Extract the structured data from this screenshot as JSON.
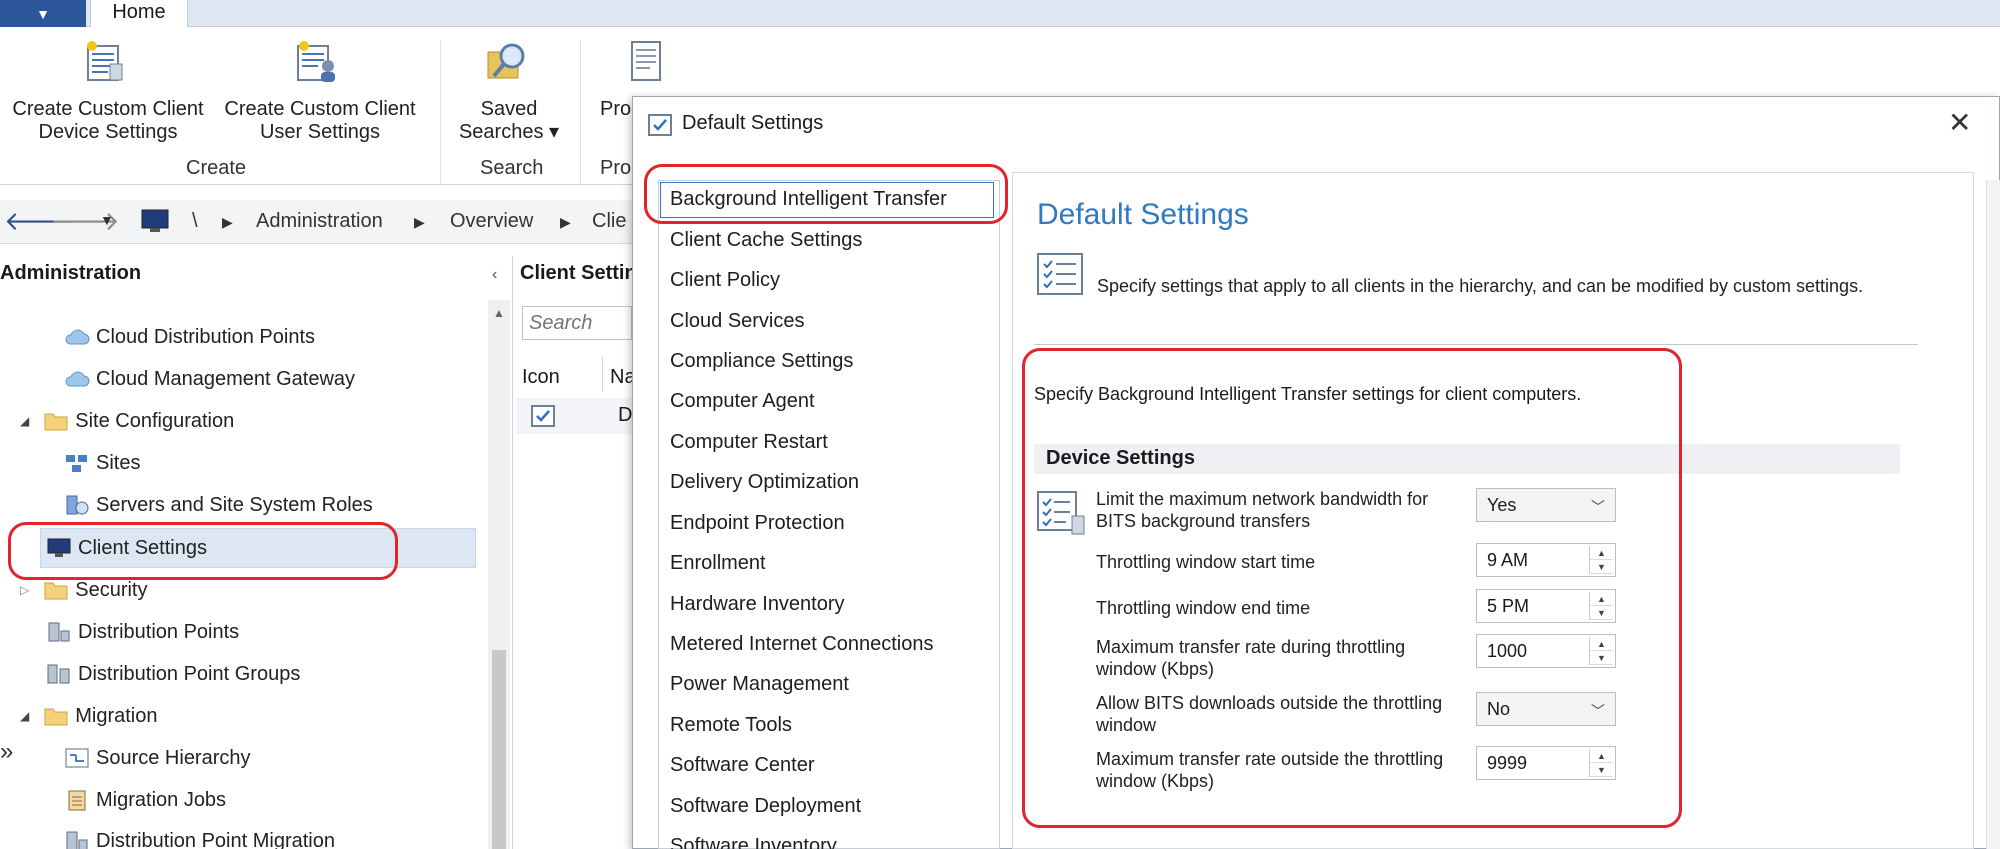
{
  "ribbon": {
    "tab_home": "Home",
    "buttons": {
      "create_device": [
        "Create Custom Client",
        "Device Settings"
      ],
      "create_user": [
        "Create Custom Client",
        "User Settings"
      ],
      "saved_searches": [
        "Saved",
        "Searches ▾"
      ],
      "properties_partial": "Pro"
    },
    "groups": {
      "create": "Create",
      "search": "Search",
      "properties": "Pro"
    }
  },
  "address_bar": {
    "root": "\\",
    "crumbs": [
      "Administration",
      "Overview",
      "Clie"
    ]
  },
  "nav": {
    "header": "Administration",
    "items": [
      {
        "label": "Cloud Distribution Points",
        "icon": "cloud-icon"
      },
      {
        "label": "Cloud Management Gateway",
        "icon": "cloud-icon"
      },
      {
        "label": "Site Configuration",
        "icon": "folder-icon"
      },
      {
        "label": "Sites",
        "icon": "sites-icon"
      },
      {
        "label": "Servers and Site System Roles",
        "icon": "server-roles-icon"
      },
      {
        "label": "Client Settings",
        "icon": "computer-icon"
      },
      {
        "label": "Security",
        "icon": "folder-icon"
      },
      {
        "label": "Distribution Points",
        "icon": "server-icon"
      },
      {
        "label": "Distribution Point Groups",
        "icon": "server-group-icon"
      },
      {
        "label": "Migration",
        "icon": "folder-icon"
      },
      {
        "label": "Source Hierarchy",
        "icon": "hierarchy-icon"
      },
      {
        "label": "Migration Jobs",
        "icon": "jobs-icon"
      },
      {
        "label": "Distribution Point Migration",
        "icon": "server-icon"
      }
    ]
  },
  "list": {
    "header": "Client Settin",
    "search_placeholder": "Search",
    "col_icon": "Icon",
    "col_name": "Na",
    "row_partial": "D"
  },
  "dialog": {
    "title": "Default Settings",
    "categories": [
      "Background Intelligent Transfer",
      "Client Cache Settings",
      "Client Policy",
      "Cloud Services",
      "Compliance Settings",
      "Computer Agent",
      "Computer Restart",
      "Delivery Optimization",
      "Endpoint Protection",
      "Enrollment",
      "Hardware Inventory",
      "Metered Internet Connections",
      "Power Management",
      "Remote Tools",
      "Software Center",
      "Software Deployment",
      "Software Inventory"
    ],
    "panel_title": "Default Settings",
    "panel_desc": "Specify settings that apply to all clients in the hierarchy, and can be modified by custom settings.",
    "bits_desc": "Specify Background Intelligent Transfer settings for client computers.",
    "device_settings_title": "Device Settings",
    "settings": [
      {
        "label": "Limit the maximum network bandwidth for BITS background transfers",
        "value": "Yes",
        "type": "select"
      },
      {
        "label": "Throttling window start time",
        "value": "9 AM",
        "type": "spin"
      },
      {
        "label": "Throttling window end time",
        "value": "5 PM",
        "type": "spin"
      },
      {
        "label": "Maximum transfer rate during throttling window (Kbps)",
        "value": "1000",
        "type": "spin"
      },
      {
        "label": "Allow BITS downloads outside the throttling window",
        "value": "No",
        "type": "select"
      },
      {
        "label": "Maximum transfer rate outside the throttling window (Kbps)",
        "value": "9999",
        "type": "spin"
      }
    ]
  },
  "colors": {
    "accent": "#2f7ac3",
    "highlight": "#e2232b",
    "ribbon": "#2b579a"
  }
}
